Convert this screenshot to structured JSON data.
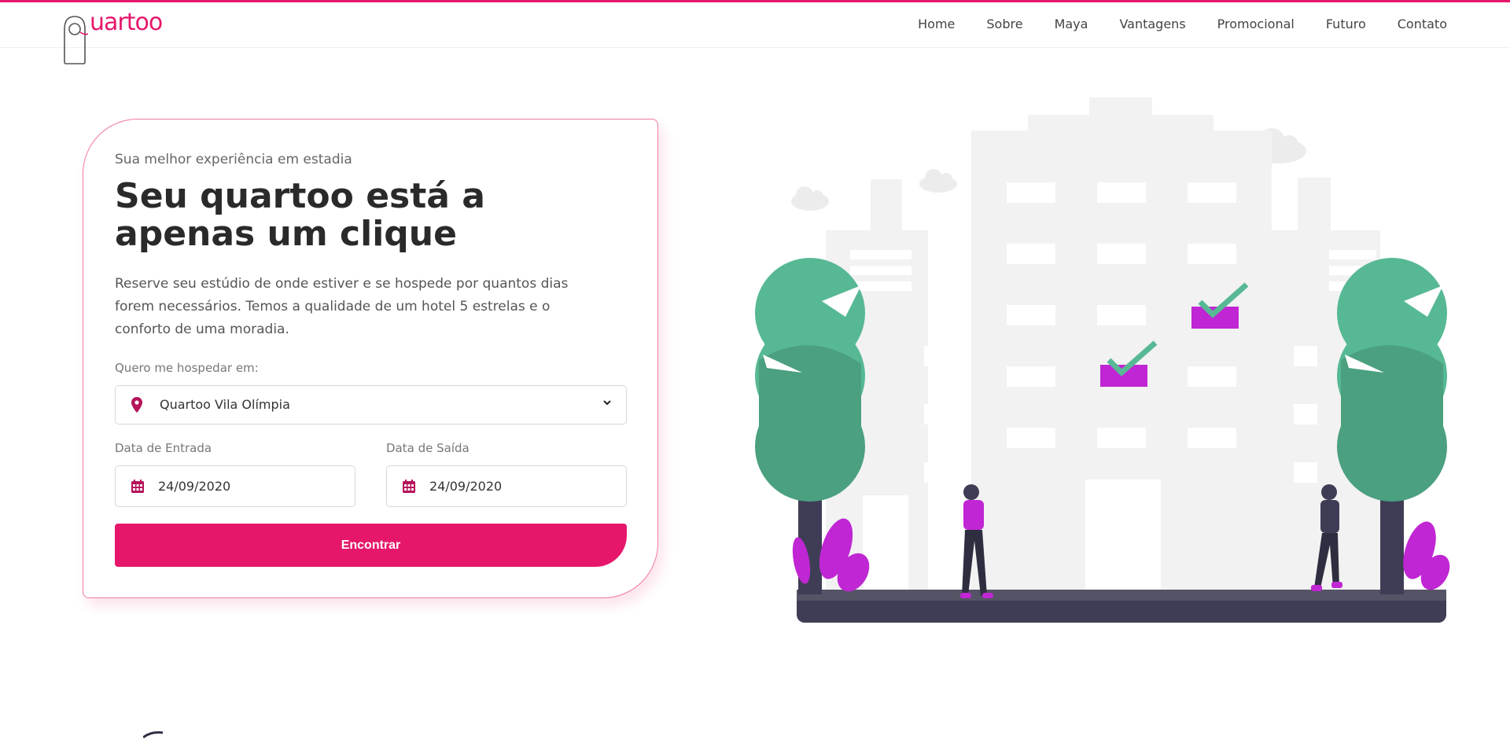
{
  "brand": {
    "name": "uartoo",
    "color": "#e6176b"
  },
  "nav": {
    "items": [
      {
        "label": "Home"
      },
      {
        "label": "Sobre"
      },
      {
        "label": "Maya"
      },
      {
        "label": "Vantagens"
      },
      {
        "label": "Promocional"
      },
      {
        "label": "Futuro"
      },
      {
        "label": "Contato"
      }
    ]
  },
  "hero": {
    "subtitle": "Sua melhor experiência em estadia",
    "title": "Seu quartoo está a apenas um clique",
    "description": "Reserve seu estúdio de onde estiver e se hospede por quantos dias forem necessários. Temos a qualidade de um hotel 5 estrelas e o conforto de uma moradia."
  },
  "form": {
    "location_label": "Quero me hospedar em:",
    "location_value": "Quartoo Vila Olímpia",
    "location_icon": "map-pin-icon",
    "checkin_label": "Data de Entrada",
    "checkin_value": "24/09/2020",
    "checkout_label": "Data de Saída",
    "checkout_value": "24/09/2020",
    "date_icon": "calendar-icon",
    "submit_label": "Encontrar"
  },
  "colors": {
    "accent": "#e6176b",
    "tree": "#57b894",
    "tree_dark": "#4aa07f",
    "purple": "#c026d3",
    "building": "#f2f2f2",
    "ground": "#3f3d56"
  }
}
